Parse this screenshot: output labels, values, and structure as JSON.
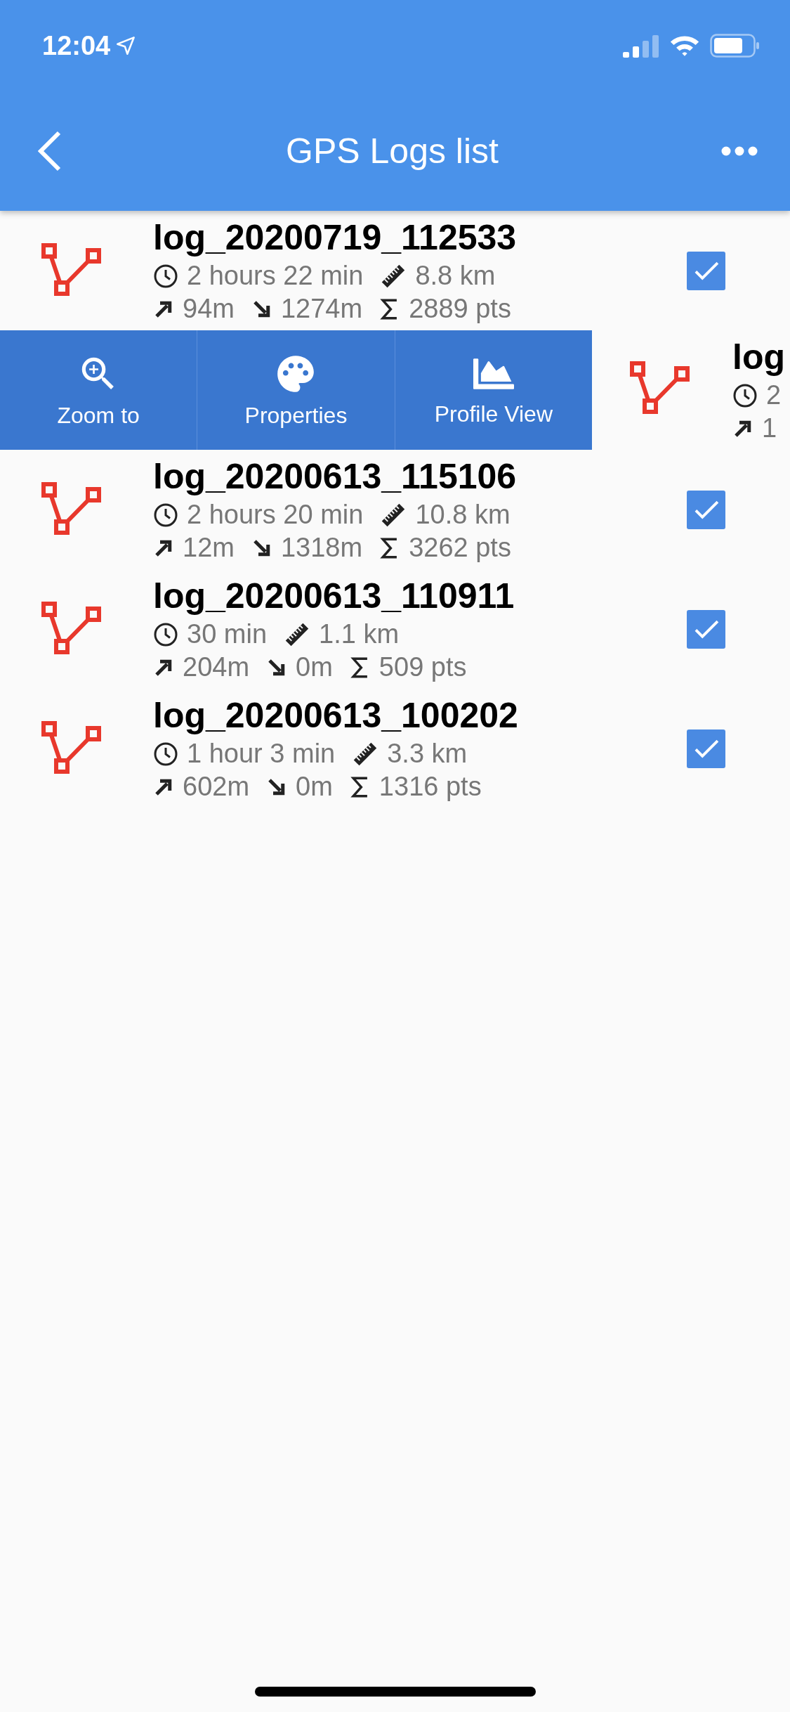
{
  "status_bar": {
    "time": "12:04"
  },
  "header": {
    "title": "GPS Logs list"
  },
  "logs": [
    {
      "kind": "row",
      "name": "log_20200719_112533",
      "duration": "2 hours 22 min",
      "length": "8.8 km",
      "ascent": "94m",
      "descent": "1274m",
      "points": "2889 pts",
      "checked": true
    },
    {
      "kind": "swiped",
      "actions": [
        {
          "label": "Zoom to",
          "kind": "zoom"
        },
        {
          "label": "Properties",
          "kind": "palette"
        },
        {
          "label": "Profile View",
          "kind": "chart"
        }
      ],
      "name": "log",
      "duration": "2",
      "ascent": "1"
    },
    {
      "kind": "row",
      "name": "log_20200613_115106",
      "duration": "2 hours 20 min",
      "length": "10.8 km",
      "ascent": "12m",
      "descent": "1318m",
      "points": "3262 pts",
      "checked": true
    },
    {
      "kind": "row",
      "name": "log_20200613_110911",
      "duration": "30 min",
      "length": "1.1 km",
      "ascent": "204m",
      "descent": "0m",
      "points": "509 pts",
      "checked": true
    },
    {
      "kind": "row",
      "name": "log_20200613_100202",
      "duration": "1 hour 3 min",
      "length": "3.3 km",
      "ascent": "602m",
      "descent": "0m",
      "points": "1316 pts",
      "checked": true
    }
  ]
}
